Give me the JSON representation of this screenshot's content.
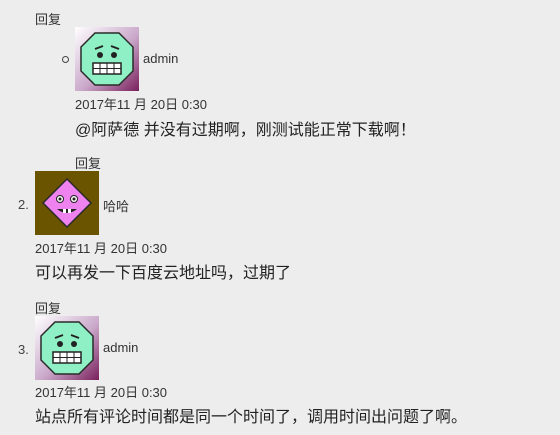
{
  "thread": [
    {
      "kind": "nested",
      "reply_top": "回复",
      "author": "admin",
      "avatar_icon": "green-worried-face-icon",
      "date": "2017年11 月 20日 0:30",
      "content": "@阿萨德 并没有过期啊，刚测试能正常下载啊！",
      "reply_bottom": "回复"
    },
    {
      "kind": "top-level",
      "number": "2.",
      "author": "哈哈",
      "avatar_icon": "pink-grinning-face-icon",
      "date": "2017年11 月 20日 0:30",
      "content": "可以再发一下百度云地址吗，过期了",
      "reply": "回复"
    },
    {
      "kind": "top-level",
      "number": "3.",
      "author": "admin",
      "avatar_icon": "green-worried-face-icon",
      "date": "2017年11 月 20日 0:30",
      "content": "站点所有评论时间都是同一个时间了，调用时间出问题了啊。"
    }
  ],
  "colors": {
    "page_bg": "#ededed",
    "green_avatar_face": "#8ef0c4",
    "pink_avatar_face": "#ee82ee",
    "olive_avatar_bg": "#6b5400"
  }
}
